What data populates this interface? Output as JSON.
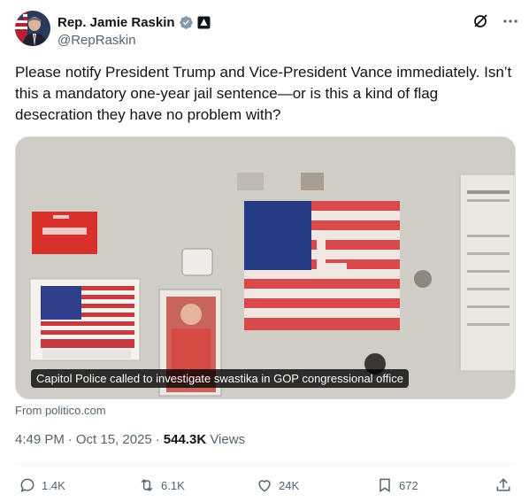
{
  "author": {
    "display_name": "Rep. Jamie Raskin",
    "handle": "@RepRaskin"
  },
  "header_icons": [
    "verified-badge-icon",
    "government-badge-icon",
    "grok-icon",
    "more-icon"
  ],
  "tweet": {
    "text": "Please notify President Trump and Vice-President Vance immediately. Isn’t this a mandatory one-year jail sentence—or is this a kind of flag desecration they have no problem with?"
  },
  "card": {
    "caption": "Capitol Police called to investigate swastika in GOP congressional office",
    "source": "From politico.com"
  },
  "meta": {
    "time": "4:49 PM",
    "separator": "·",
    "date": "Oct 15, 2025",
    "views_count": "544.3K",
    "views_label": "Views"
  },
  "actions": {
    "replies": "1.4K",
    "reposts": "6.1K",
    "likes": "24K",
    "bookmarks": "672"
  },
  "colors": {
    "text": "#0f1419",
    "secondary": "#536471",
    "verified": "#829aab",
    "divider": "#eff3f4"
  }
}
